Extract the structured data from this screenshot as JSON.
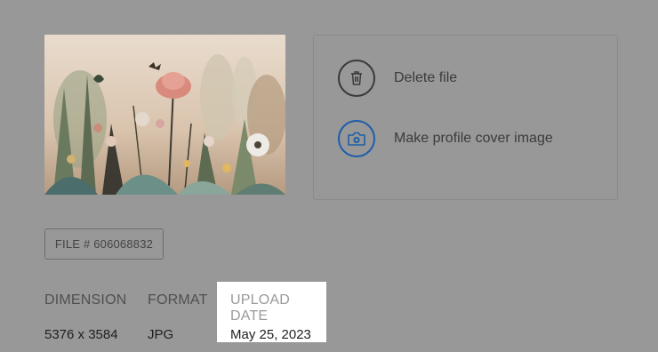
{
  "thumbnail": {
    "alt_icon": "floral-illustration-image"
  },
  "actions": {
    "delete_label": "Delete file",
    "delete_icon": "trash-icon",
    "cover_label": "Make profile cover image",
    "cover_icon": "camera-icon",
    "cover_accent": "#1e5ea8"
  },
  "file": {
    "badge": "FILE # 606068832"
  },
  "meta": {
    "dimension_label": "DIMENSION",
    "dimension_value": "5376 x 3584",
    "format_label": "FORMAT",
    "format_value": "JPG",
    "upload_label": "UPLOAD DATE",
    "upload_value": "May 25, 2023"
  }
}
